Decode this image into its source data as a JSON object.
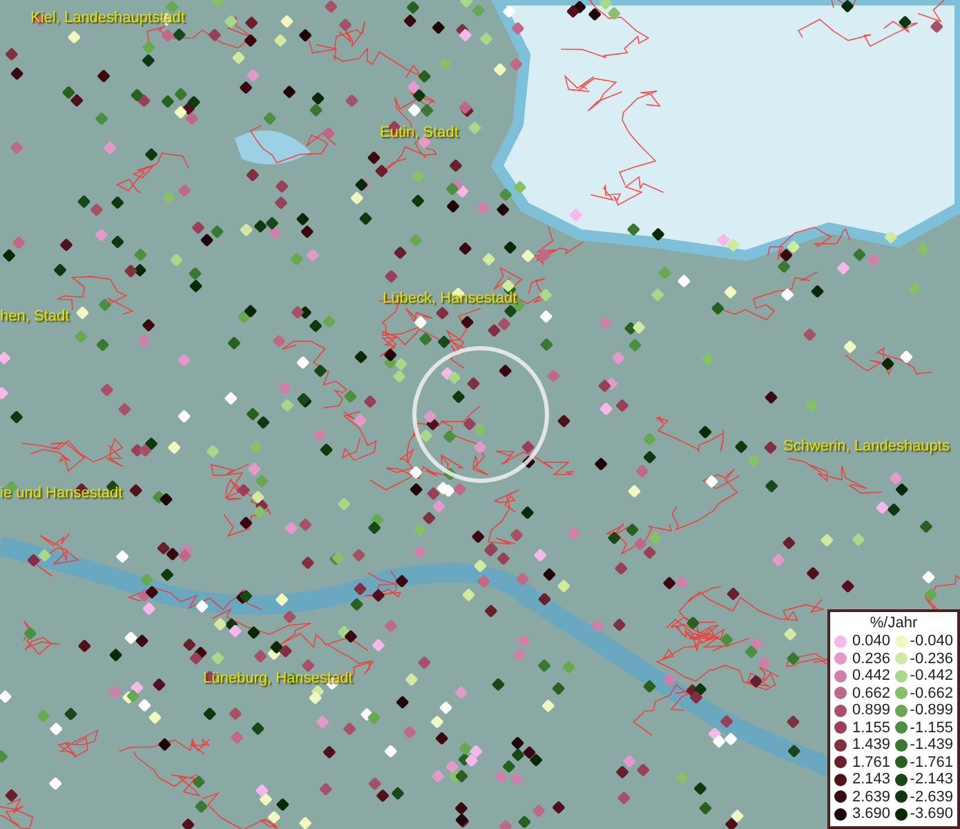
{
  "map": {
    "places": [
      {
        "name": "Kiel, Landeshauptstadt"
      },
      {
        "name": "Eutin, Stadt"
      },
      {
        "name": "hen, Stadt"
      },
      {
        "name": "Lübeck, Hansestadt"
      },
      {
        "name": "Schwerin, Landeshaupts"
      },
      {
        "name": "ie und Hansestadt"
      },
      {
        "name": "Lüneburg, Hansestadt"
      }
    ]
  },
  "legend": {
    "title": "%/Jahr",
    "rows": [
      {
        "positive": {
          "label": "0.040",
          "color": "#f5b8e8"
        },
        "negative": {
          "label": "-0.040",
          "color": "#f0f8c0"
        }
      },
      {
        "positive": {
          "label": "0.236",
          "color": "#e39ac8"
        },
        "negative": {
          "label": "-0.236",
          "color": "#d0eaa0"
        }
      },
      {
        "positive": {
          "label": "0.442",
          "color": "#d080a8"
        },
        "negative": {
          "label": "-0.442",
          "color": "#a8d888"
        }
      },
      {
        "positive": {
          "label": "0.662",
          "color": "#c06888"
        },
        "negative": {
          "label": "-0.662",
          "color": "#88c068"
        }
      },
      {
        "positive": {
          "label": "0.899",
          "color": "#a85068"
        },
        "negative": {
          "label": "-0.899",
          "color": "#68a850"
        }
      },
      {
        "positive": {
          "label": "1.155",
          "color": "#984058"
        },
        "negative": {
          "label": "-1.155",
          "color": "#4a9040"
        }
      },
      {
        "positive": {
          "label": "1.439",
          "color": "#803040"
        },
        "negative": {
          "label": "-1.439",
          "color": "#387830"
        }
      },
      {
        "positive": {
          "label": "1.761",
          "color": "#6a1f2c"
        },
        "negative": {
          "label": "-1.761",
          "color": "#286020"
        }
      },
      {
        "positive": {
          "label": "2.143",
          "color": "#50101c"
        },
        "negative": {
          "label": "-2.143",
          "color": "#184818"
        }
      },
      {
        "positive": {
          "label": "2.639",
          "color": "#3a0810"
        },
        "negative": {
          "label": "-2.639",
          "color": "#103810"
        }
      },
      {
        "positive": {
          "label": "3.690",
          "color": "#200408"
        },
        "negative": {
          "label": "-3.690",
          "color": "#082808"
        }
      }
    ]
  }
}
